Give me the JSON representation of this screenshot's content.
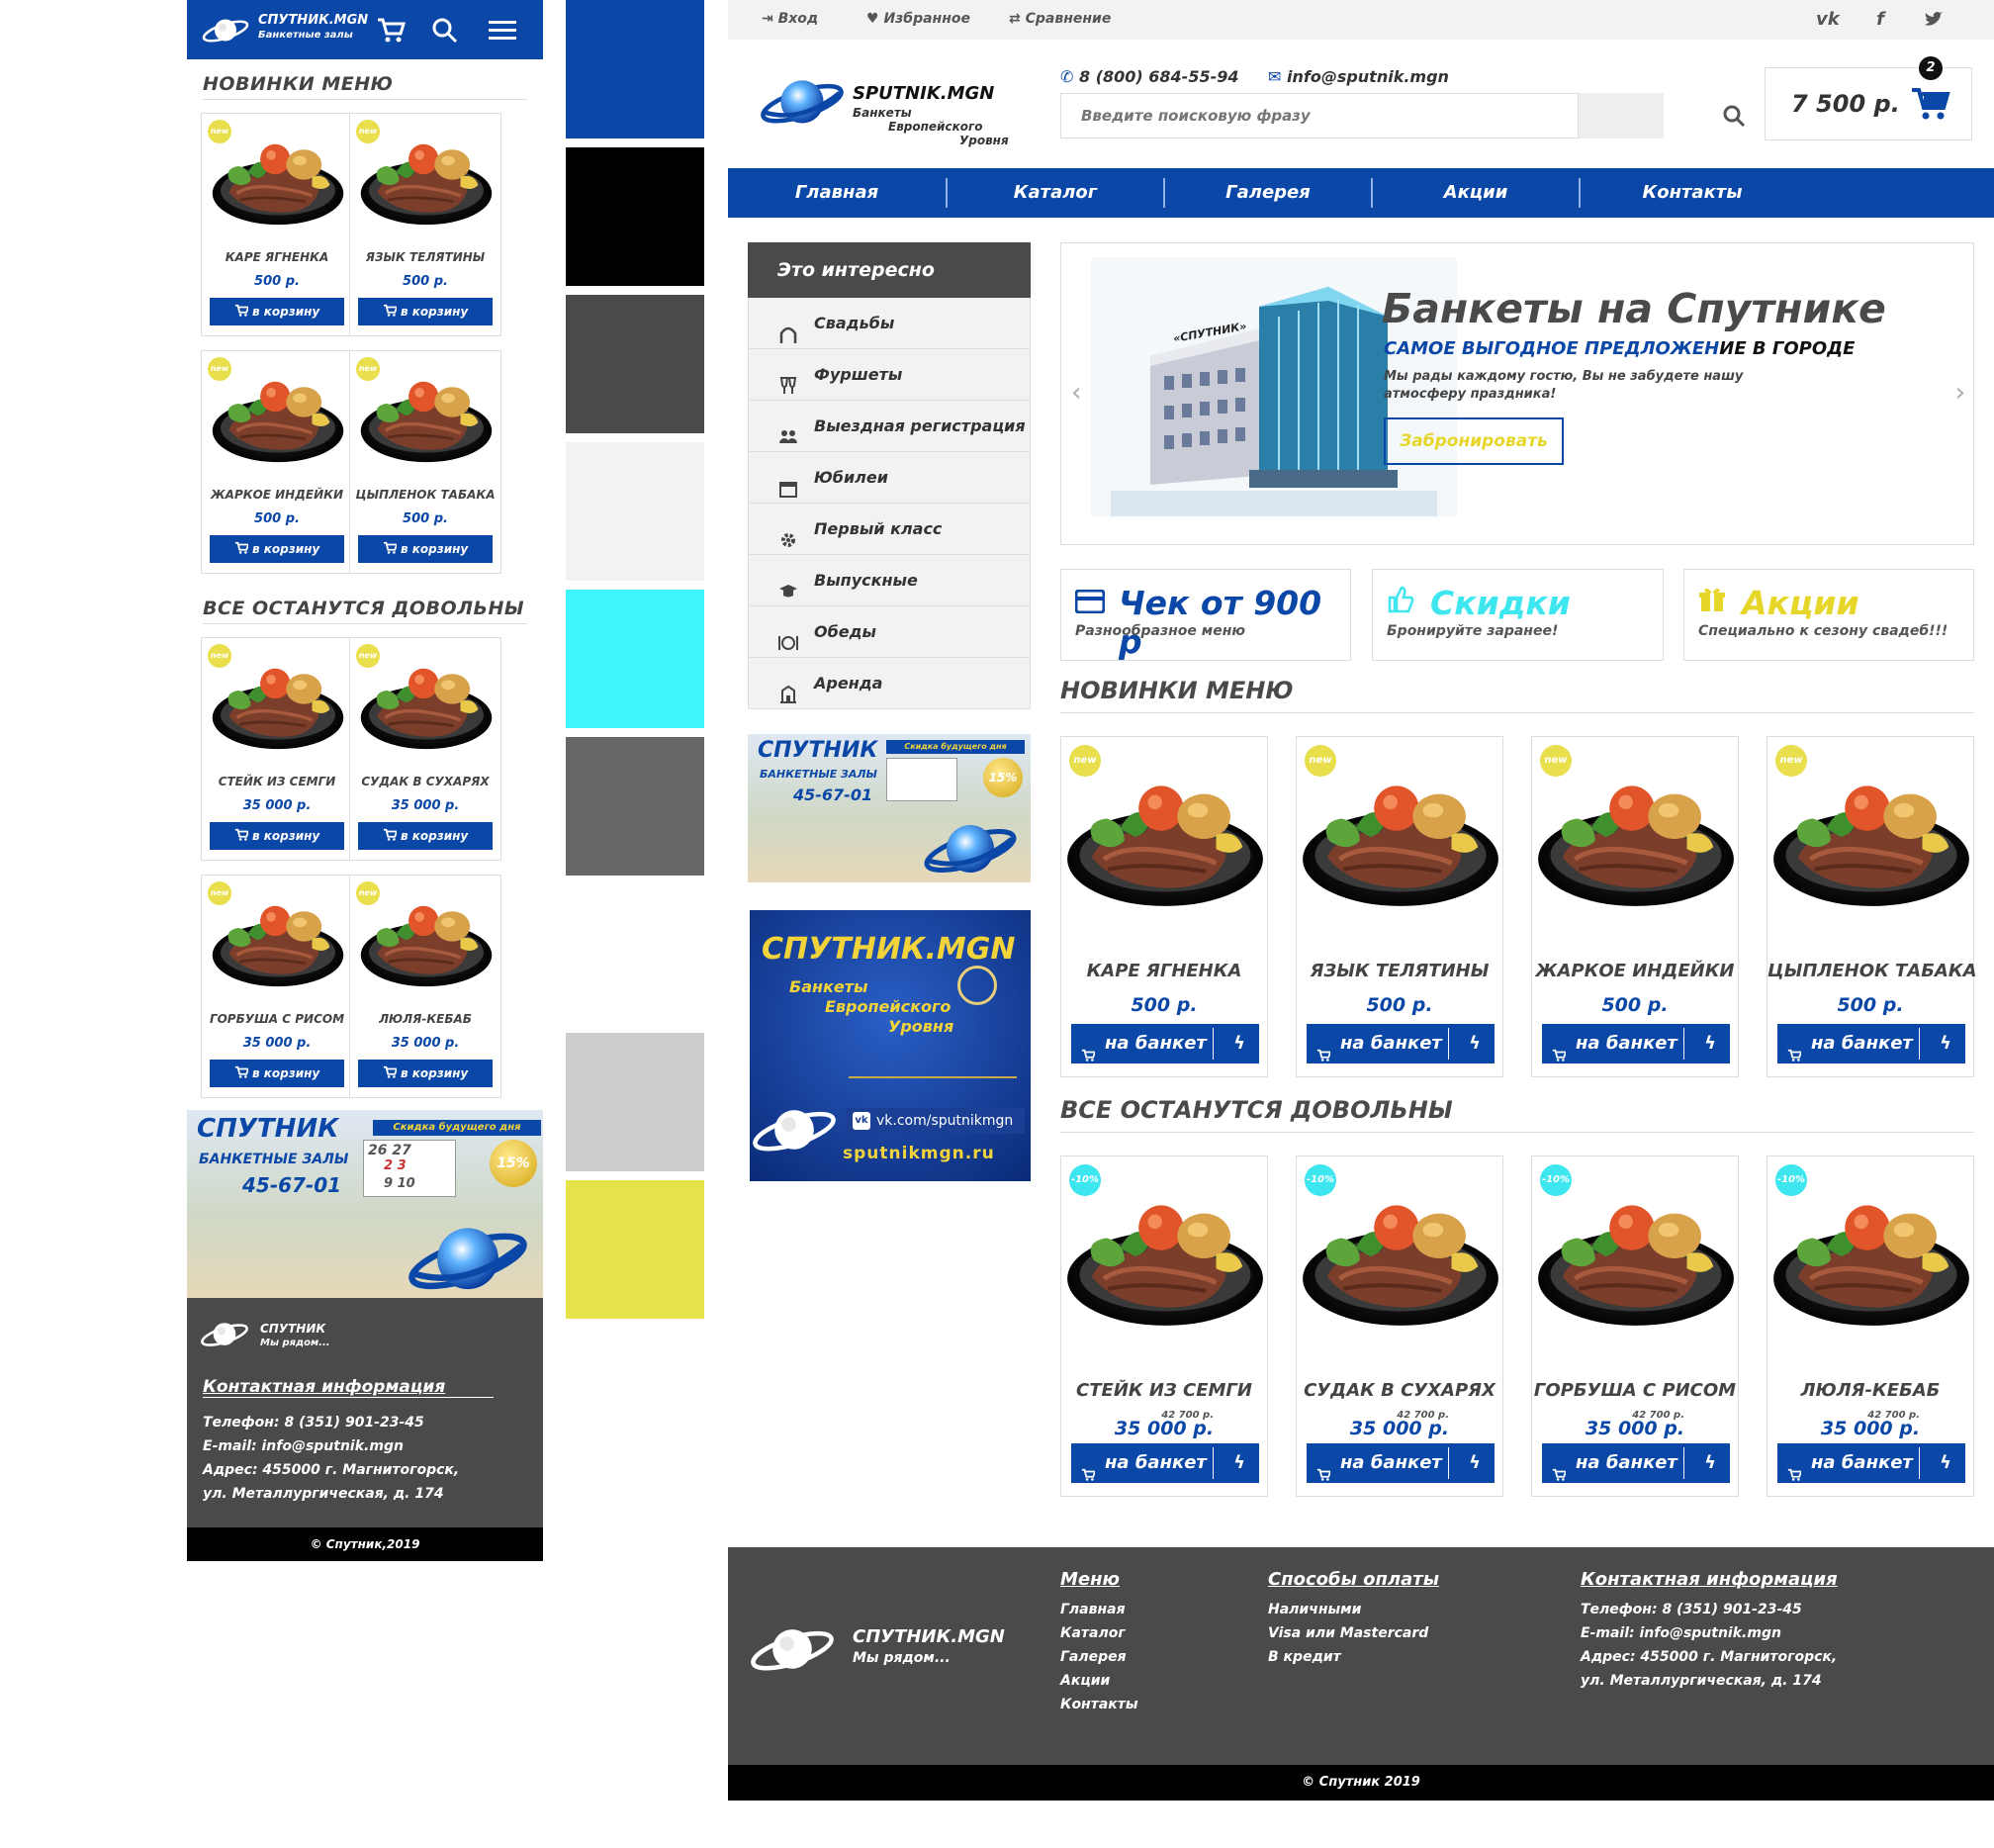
{
  "mobile": {
    "brand": "СПУТНИК.MGN",
    "subbrand": "Банкетные залы",
    "section_new": "НОВИНКИ МЕНЮ",
    "section_all": "ВСЕ ОСТАНУТСЯ ДОВОЛЬНЫ",
    "new_items": [
      {
        "name": "КАРЕ ЯГНЕНКА",
        "price": "500 р.",
        "button": "в корзину"
      },
      {
        "name": "ЯЗЫК ТЕЛЯТИНЫ",
        "price": "500 р.",
        "button": "в корзину"
      },
      {
        "name": "ЖАРКОЕ ИНДЕЙКИ",
        "price": "500 р.",
        "button": "в корзину"
      },
      {
        "name": "ЦЫПЛЕНОК ТАБАКА",
        "price": "500 р.",
        "button": "в корзину"
      }
    ],
    "all_items": [
      {
        "name": "СТЕЙК ИЗ СЕМГИ",
        "price": "35 000 р.",
        "button": "в корзину"
      },
      {
        "name": "СУДАК В СУХАРЯХ",
        "price": "35 000 р.",
        "button": "в корзину"
      },
      {
        "name": "ГОРБУША С РИСОМ",
        "price": "35 000 р.",
        "button": "в корзину"
      },
      {
        "name": "ЛЮЛЯ-КЕБАБ",
        "price": "35 000 р.",
        "button": "в корзину"
      }
    ],
    "badge_new": "new",
    "promo": {
      "title": "СПУТНИК",
      "sub": "БАНКЕТНЫЕ ЗАЛЫ",
      "phone": "45-67-01",
      "ribbon": "Скидка будущего дня",
      "percent": "15%",
      "dates": [
        "26",
        "27",
        "2",
        "3",
        "9",
        "10"
      ]
    },
    "footer": {
      "brand": "СПУТНИК",
      "slogan": "Мы рядом...",
      "contacts_title": "Контактная информация",
      "phone": "Телефон: 8 (351) 901-23-45",
      "email": "E-mail: info@sputnik.mgn",
      "address1": "Адрес: 455000 г. Магнитогорск,",
      "address2": "ул. Металлургическая, д. 174",
      "copyright": "© Спутник,2019"
    }
  },
  "palette": [
    "#0a47a6",
    "#000000",
    "#4a4a4a",
    "#f2f2f2",
    "#3ef6fb",
    "#666666",
    "#cccccc",
    "#e6e24a"
  ],
  "desktop": {
    "topbar": {
      "login": "Вход",
      "favorites": "Избранное",
      "compare": "Сравнение"
    },
    "social": [
      "vk",
      "f",
      "tw"
    ],
    "logo": {
      "brand": "SPUTNIK.MGN",
      "line1": "Банкеты",
      "line2": "Европейского",
      "line3": "Уровня"
    },
    "phone": "8 (800) 684-55-94",
    "email": "info@sputnik.mgn",
    "search_placeholder": "Введите поисковую фразу",
    "cart": {
      "total": "7 500 р.",
      "count": "2"
    },
    "nav": [
      "Главная",
      "Каталог",
      "Галерея",
      "Акции",
      "Контакты"
    ],
    "sidebar": {
      "title": "Это интересно",
      "items": [
        "Свадьбы",
        "Фуршеты",
        "Выездная регистрация",
        "Юбилеи",
        "Первый класс",
        "Выпускные",
        "Обеды",
        "Аренда"
      ]
    },
    "banner2": {
      "title": "СПУТНИК.MGN",
      "l1": "Банкеты",
      "l2": "Европейского",
      "l3": "Уровня",
      "vk": "vk.com/sputnikmgn",
      "site": "sputnikmgn.ru"
    },
    "hero": {
      "title": "Банкеты на Спутнике",
      "subtitle_blue": "САМОЕ ВЫГОДНОЕ ПРЕДЛОЖЕН",
      "subtitle_black": "ИЕ В ГОРОДЕ",
      "text1": "Мы рады каждому гостю, Вы не забудете нашу",
      "text2": "атмосферу праздника!",
      "button": "Забронировать",
      "building_sign": "«СПУТНИК»"
    },
    "info": [
      {
        "title": "Чек от 900 р",
        "sub": "Разнообразное меню",
        "color": "#0a47a6"
      },
      {
        "title": "Скидки",
        "sub": "Бронируйте заранее!",
        "color": "#3ee6f0"
      },
      {
        "title": "Акции",
        "sub": "Специально к сезону свадеб!!!",
        "color": "#e6d62a"
      }
    ],
    "section_new": "НОВИНКИ МЕНЮ",
    "section_all": "ВСЕ ОСТАНУТСЯ ДОВОЛЬНЫ",
    "badge_new": "new",
    "badge_sale": "-10%",
    "new_items": [
      {
        "name": "КАРЕ ЯГНЕНКА",
        "price": "500 р.",
        "button": "на банкет"
      },
      {
        "name": "ЯЗЫК ТЕЛЯТИНЫ",
        "price": "500 р.",
        "button": "на банкет"
      },
      {
        "name": "ЖАРКОЕ ИНДЕЙКИ",
        "price": "500 р.",
        "button": "на банкет"
      },
      {
        "name": "ЦЫПЛЕНОК ТАБАКА",
        "price": "500 р.",
        "button": "на банкет"
      }
    ],
    "all_items": [
      {
        "name": "СТЕЙК ИЗ СЕМГИ",
        "old": "42 700 р.",
        "price": "35 000 р.",
        "button": "на банкет"
      },
      {
        "name": "СУДАК В СУХАРЯХ",
        "old": "42 700 р.",
        "price": "35 000 р.",
        "button": "на банкет"
      },
      {
        "name": "ГОРБУША С РИСОМ",
        "old": "42 700 р.",
        "price": "35 000 р.",
        "button": "на банкет"
      },
      {
        "name": "ЛЮЛЯ-КЕБАБ",
        "old": "42 700 р.",
        "price": "35 000 р.",
        "button": "на банкет"
      }
    ],
    "footer": {
      "brand": "СПУТНИК.MGN",
      "slogan": "Мы рядом...",
      "menu_title": "Меню",
      "menu": [
        "Главная",
        "Каталог",
        "Галерея",
        "Акции",
        "Контакты"
      ],
      "pay_title": "Способы оплаты",
      "pay": [
        "Наличными",
        "Visa или Mastercard",
        "В кредит"
      ],
      "contacts_title": "Контактная информация",
      "phone": "Телефон: 8 (351) 901-23-45",
      "email": "E-mail: info@sputnik.mgn",
      "address1": "Адрес: 455000 г. Магнитогорск,",
      "address2": "ул. Металлургическая, д. 174",
      "copyright": "© Спутник 2019"
    }
  }
}
